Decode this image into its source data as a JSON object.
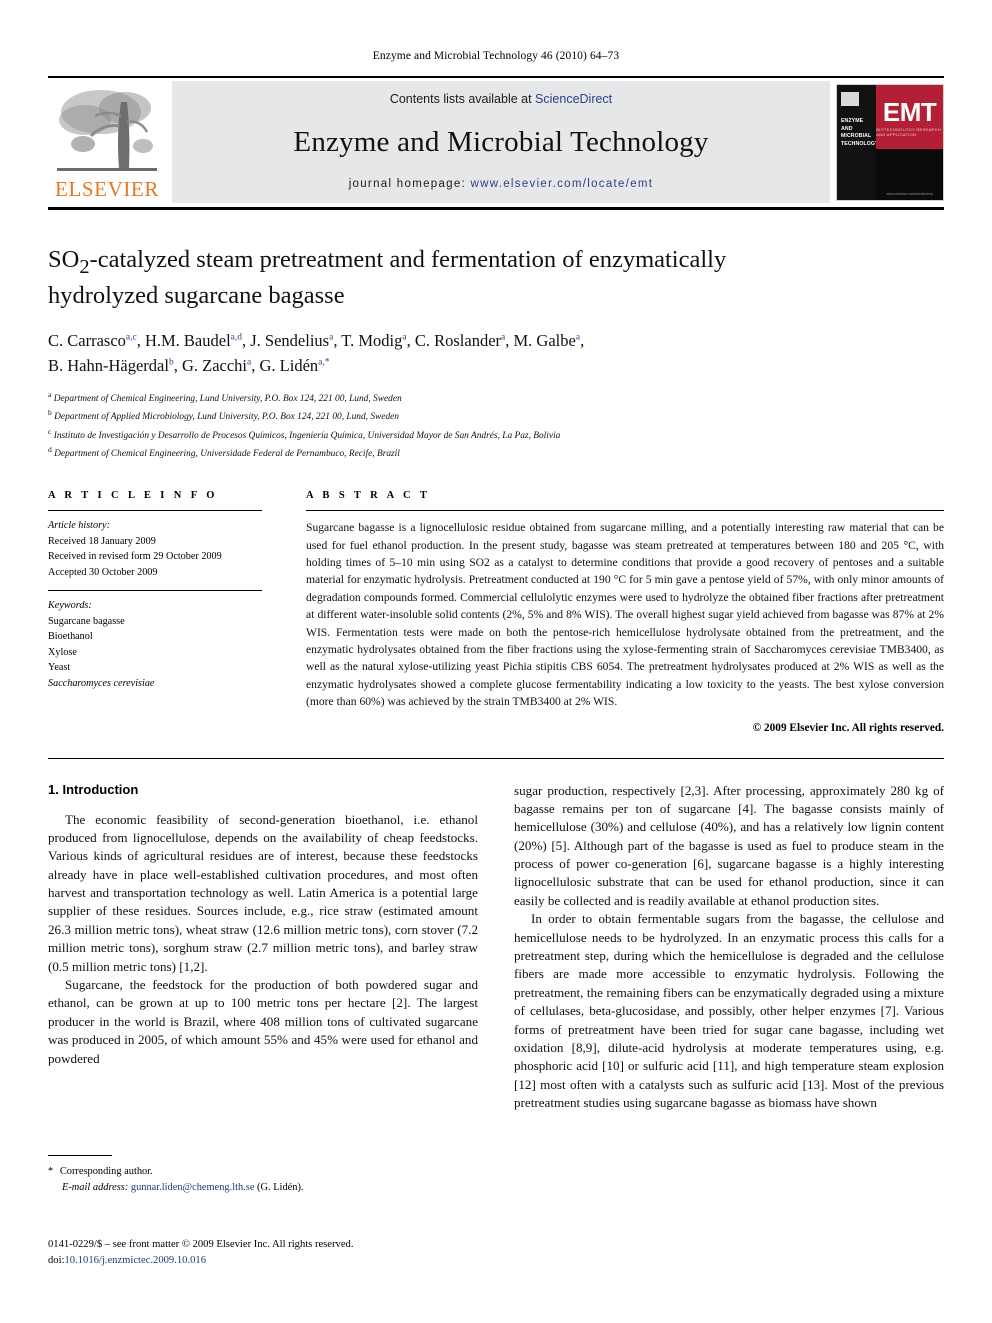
{
  "running_head": "Enzyme and Microbial Technology 46 (2010) 64–73",
  "masthead": {
    "contents_prefix": "Contents lists available at ",
    "sciencedirect": "ScienceDirect",
    "journal_name": "Enzyme and Microbial Technology",
    "homepage_label": "journal homepage: ",
    "homepage_url": "www.elsevier.com/locate/emt",
    "publisher_wordmark": "ELSEVIER",
    "cover": {
      "journal_lines": "ENZYME AND MICROBIAL TECHNOLOGY",
      "acronym": "EMT",
      "tagline": "BIOTECHNOLOGY RESEARCH AND APPLICATION",
      "url": "www.elsevier.com/locate/emt"
    },
    "accent_orange": "#E87722",
    "link_blue": "#2b3f8c",
    "cover_red": "#b41f35"
  },
  "article": {
    "title": "SO2-catalyzed steam pretreatment and fermentation of enzymatically hydrolyzed sugarcane bagasse",
    "title_part1": "SO",
    "title_sub": "2",
    "title_part2": "-catalyzed steam pretreatment and fermentation of enzymatically hydrolyzed sugarcane bagasse",
    "authors_line1": "C. Carrasco",
    "authors": [
      {
        "name": "C. Carrasco",
        "sup": "a,c"
      },
      {
        "name": "H.M. Baudel",
        "sup": "a,d"
      },
      {
        "name": "J. Sendelius",
        "sup": "a"
      },
      {
        "name": "T. Modig",
        "sup": "a"
      },
      {
        "name": "C. Roslander",
        "sup": "a"
      },
      {
        "name": "M. Galbe",
        "sup": "a"
      },
      {
        "name": "B. Hahn-Hägerdal",
        "sup": "b"
      },
      {
        "name": "G. Zacchi",
        "sup": "a"
      },
      {
        "name": "G. Lidén",
        "sup": "a,*"
      }
    ],
    "affiliations": [
      {
        "marker": "a",
        "text": "Department of Chemical Engineering, Lund University, P.O. Box 124, 221 00, Lund, Sweden"
      },
      {
        "marker": "b",
        "text": "Department of Applied Microbiology, Lund University, P.O. Box 124, 221 00, Lund, Sweden"
      },
      {
        "marker": "c",
        "text": "Instituto de Investigación y Desarrollo de Procesos Químicos, Ingeniería Química, Universidad Mayor de San Andrés, La Paz, Bolivia"
      },
      {
        "marker": "d",
        "text": "Department of Chemical Engineering, Universidade Federal de Pernambuco, Recife, Brazil"
      }
    ]
  },
  "info": {
    "heading": "A R T I C L E   I N F O",
    "history_label": "Article history:",
    "history": [
      "Received 18 January 2009",
      "Received in revised form 29 October 2009",
      "Accepted 30 October 2009"
    ],
    "keywords_label": "Keywords:",
    "keywords": [
      "Sugarcane bagasse",
      "Bioethanol",
      "Xylose",
      "Yeast"
    ],
    "keyword_italic": "Saccharomyces cerevisiae"
  },
  "abstract": {
    "heading": "A B S T R A C T",
    "text": "Sugarcane bagasse is a lignocellulosic residue obtained from sugarcane milling, and a potentially interesting raw material that can be used for fuel ethanol production. In the present study, bagasse was steam pretreated at temperatures between 180 and 205 °C, with holding times of 5–10 min using SO2 as a catalyst to determine conditions that provide a good recovery of pentoses and a suitable material for enzymatic hydrolysis. Pretreatment conducted at 190 °C for 5 min gave a pentose yield of 57%, with only minor amounts of degradation compounds formed. Commercial cellulolytic enzymes were used to hydrolyze the obtained fiber fractions after pretreatment at different water-insoluble solid contents (2%, 5% and 8% WIS). The overall highest sugar yield achieved from bagasse was 87% at 2% WIS. Fermentation tests were made on both the pentose-rich hemicellulose hydrolysate obtained from the pretreatment, and the enzymatic hydrolysates obtained from the fiber fractions using the xylose-fermenting strain of Saccharomyces cerevisiae TMB3400, as well as the natural xylose-utilizing yeast Pichia stipitis CBS 6054. The pretreatment hydrolysates produced at 2% WIS as well as the enzymatic hydrolysates showed a complete glucose fermentability indicating a low toxicity to the yeasts. The best xylose conversion (more than 60%) was achieved by the strain TMB3400 at 2% WIS.",
    "copyright": "© 2009 Elsevier Inc. All rights reserved."
  },
  "body": {
    "section_number_title": "1.  Introduction",
    "left_paragraphs": [
      "The economic feasibility of second-generation bioethanol, i.e. ethanol produced from lignocellulose, depends on the availability of cheap feedstocks. Various kinds of agricultural residues are of interest, because these feedstocks already have in place well-established cultivation procedures, and most often harvest and transportation technology as well. Latin America is a potential large supplier of these residues. Sources include, e.g., rice straw (estimated amount 26.3 million metric tons), wheat straw (12.6 million metric tons), corn stover (7.2 million metric tons), sorghum straw (2.7 million metric tons), and barley straw (0.5 million metric tons) [1,2].",
      "Sugarcane, the feedstock for the production of both powdered sugar and ethanol, can be grown at up to 100 metric tons per hectare [2]. The largest producer in the world is Brazil, where 408 million tons of cultivated sugarcane was produced in 2005, of which amount 55% and 45% were used for ethanol and powdered"
    ],
    "right_paragraphs": [
      "sugar production, respectively [2,3]. After processing, approximately 280 kg of bagasse remains per ton of sugarcane [4]. The bagasse consists mainly of hemicellulose (30%) and cellulose (40%), and has a relatively low lignin content (20%) [5]. Although part of the bagasse is used as fuel to produce steam in the process of power co-generation [6], sugarcane bagasse is a highly interesting lignocellulosic substrate that can be used for ethanol production, since it can easily be collected and is readily available at ethanol production sites.",
      "In order to obtain fermentable sugars from the bagasse, the cellulose and hemicellulose needs to be hydrolyzed. In an enzymatic process this calls for a pretreatment step, during which the hemicellulose is degraded and the cellulose fibers are made more accessible to enzymatic hydrolysis. Following the pretreatment, the remaining fibers can be enzymatically degraded using a mixture of cellulases, beta-glucosidase, and possibly, other helper enzymes [7]. Various forms of pretreatment have been tried for sugar cane bagasse, including wet oxidation [8,9], dilute-acid hydrolysis at moderate temperatures using, e.g. phosphoric acid [10] or sulfuric acid [11], and high temperature steam explosion [12] most often with a catalysts such as sulfuric acid [13]. Most of the previous pretreatment studies using sugarcane bagasse as biomass have shown"
    ]
  },
  "footnote": {
    "star": "*",
    "corresponding": "Corresponding author.",
    "email_label": "E-mail address:",
    "email": "gunnar.liden@chemeng.lth.se",
    "email_owner": "(G. Lidén)."
  },
  "imprint": {
    "line1": "0141-0229/$ – see front matter © 2009 Elsevier Inc. All rights reserved.",
    "doi_label": "doi:",
    "doi": "10.1016/j.enzmictec.2009.10.016"
  }
}
